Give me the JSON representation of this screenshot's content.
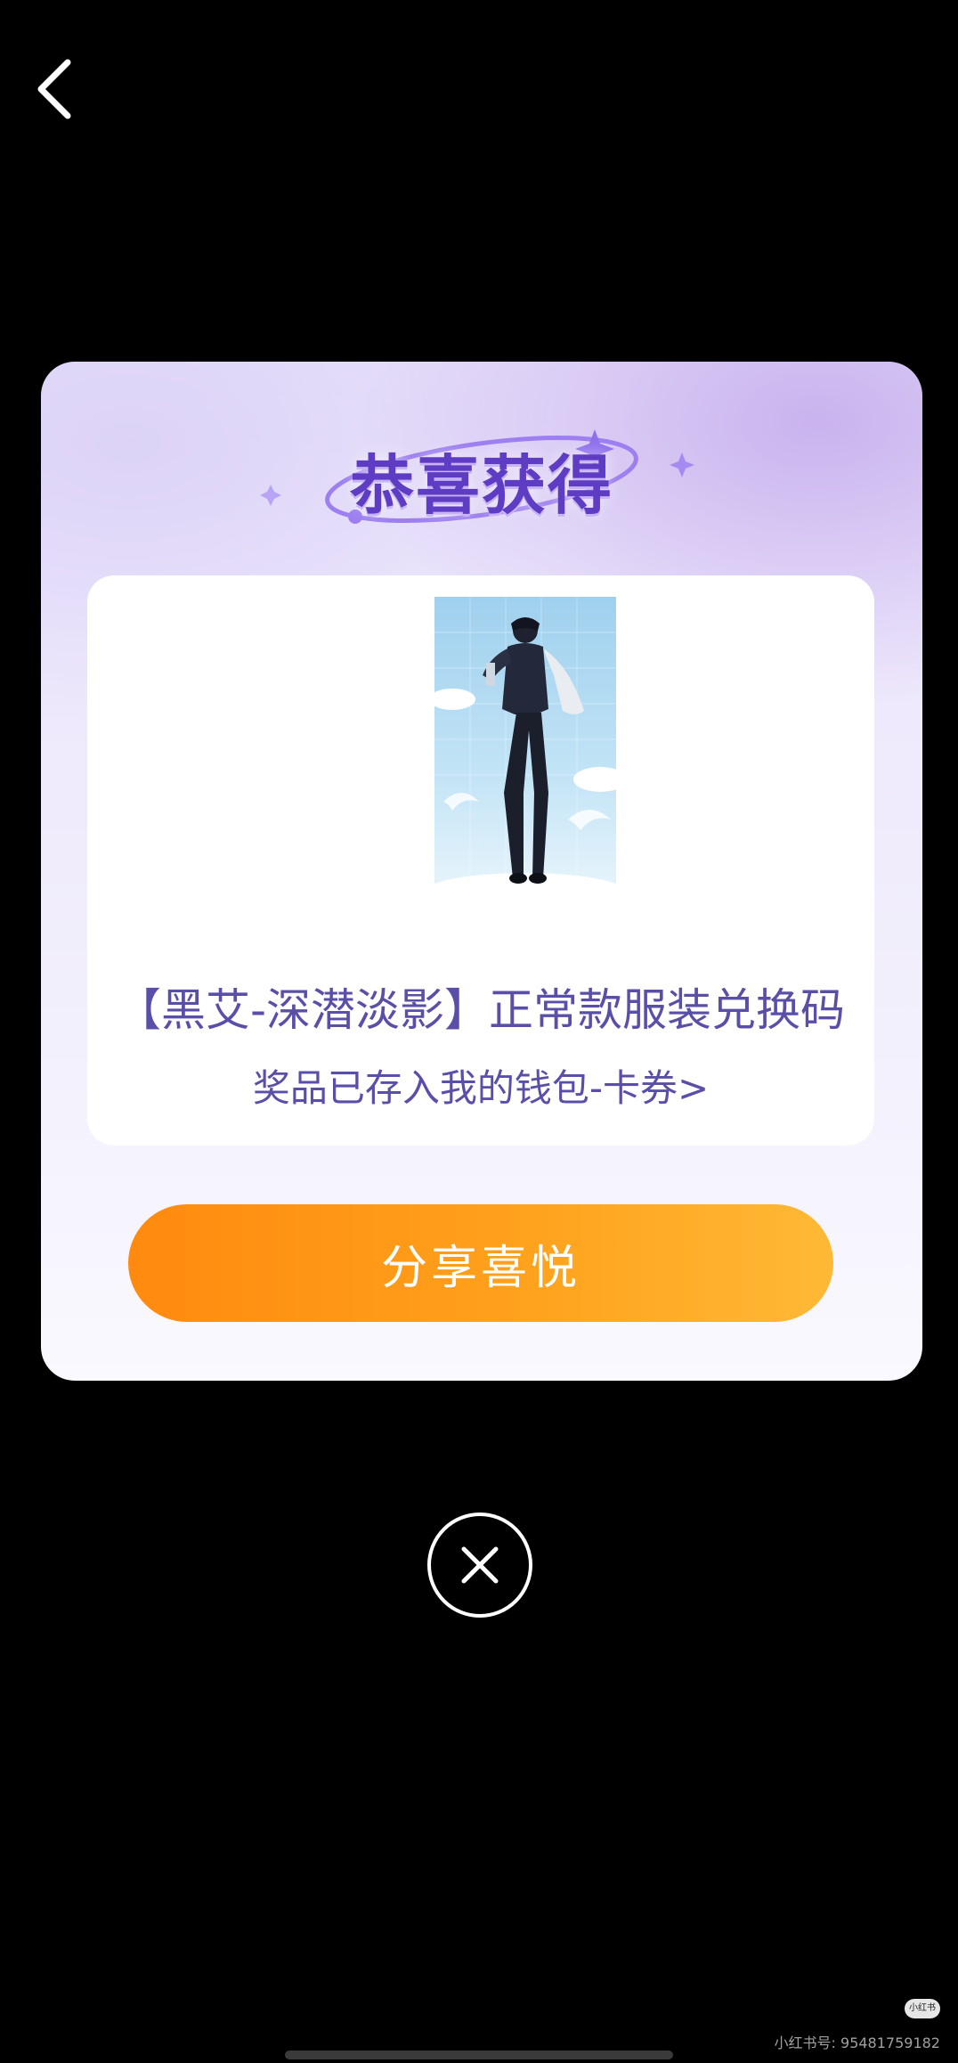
{
  "nav": {
    "back_icon": "chevron-left-icon"
  },
  "popup": {
    "title": "恭喜获得",
    "prize_name": "【黑艾-深潜淡影】正常款服装兑换码",
    "prize_location_link": "奖品已存入我的钱包-卡券>",
    "share_button_label": "分享喜悦",
    "close_icon": "close-icon"
  },
  "watermark": {
    "logo_text": "小红书",
    "text": "小红书号: 95481759182"
  },
  "colors": {
    "title_purple": "#5f3cc4",
    "text_purple": "#5a4fa8",
    "button_orange_start": "#ff8a0f",
    "button_orange_end": "#ffb936",
    "background": "#000000"
  }
}
